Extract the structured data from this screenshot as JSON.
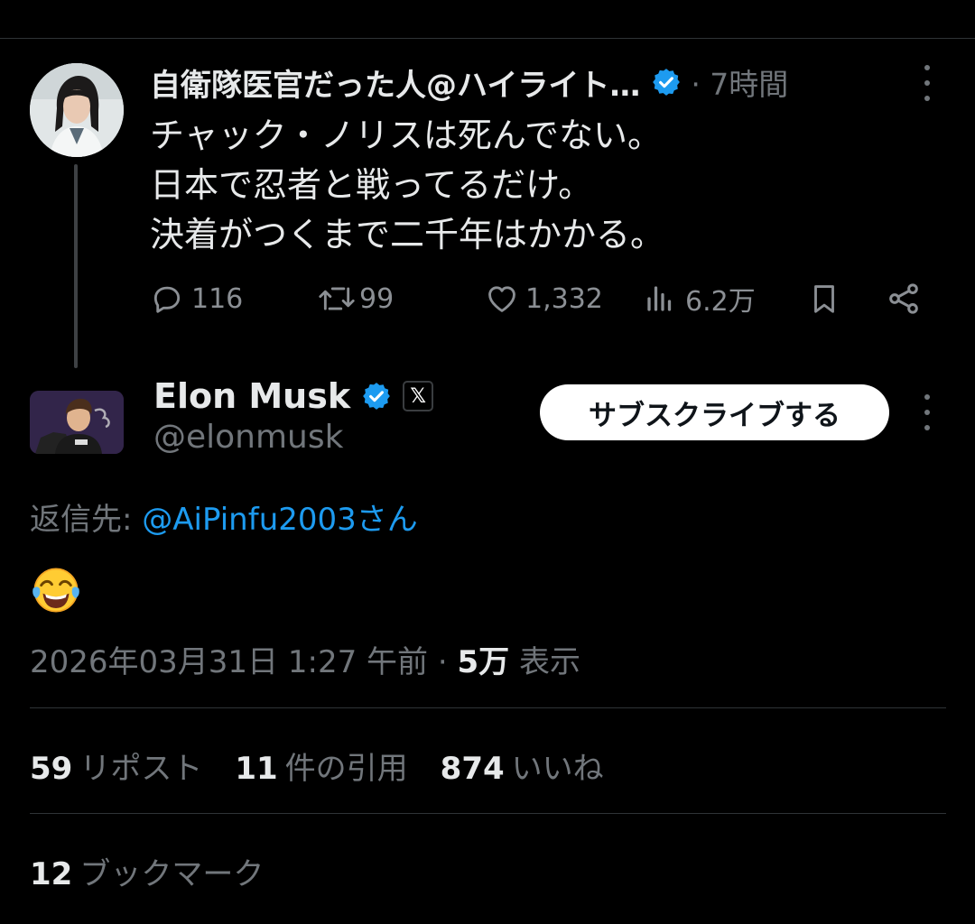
{
  "parent_tweet": {
    "author_name": "自衛隊医官だった人@ハイライト…",
    "time": "· 7時間",
    "text_lines": [
      "チャック・ノリスは死んでない。",
      "日本で忍者と戦ってるだけ。",
      "決着がつくまで二千年はかかる。"
    ],
    "actions": {
      "replies": "116",
      "reposts": "99",
      "likes": "1,332",
      "views": "6.2万"
    }
  },
  "main_tweet": {
    "author_name": "Elon Musk",
    "handle": "@elonmusk",
    "affiliate_badge": "𝕏",
    "subscribe_label": "サブスクライブする",
    "reply_prefix": "返信先: ",
    "reply_to": "@AiPinfu2003さん",
    "content_emoji": "face-with-tears-of-joy",
    "timestamp": "2026年03月31日 1:27 午前",
    "separator": " · ",
    "views_count": "5万",
    "views_label": "表示",
    "stats": {
      "reposts_count": "59",
      "reposts_label": "リポスト",
      "quotes_count": "11",
      "quotes_label": "件の引用",
      "likes_count": "874",
      "likes_label": "いいね",
      "bookmarks_count": "12",
      "bookmarks_label": "ブックマーク"
    }
  },
  "colors": {
    "background": "#000000",
    "text_primary": "#e7e9ea",
    "text_secondary": "#71767b",
    "link": "#1d9bf0",
    "verified_badge": "#1d9bf0",
    "divider": "#2f3336"
  }
}
